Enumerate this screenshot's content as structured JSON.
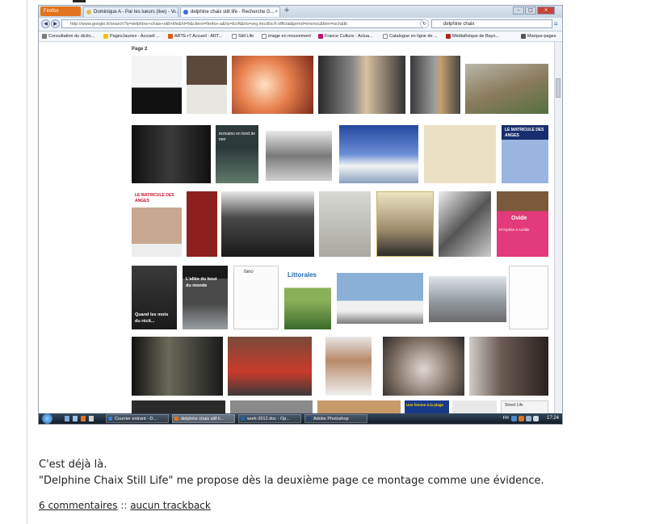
{
  "browser": {
    "app_button": "Firefox",
    "tabs": [
      {
        "label": "Dominique A - Par les lueurs (live) - V...",
        "active": false,
        "icon_color": "#d9c25a"
      },
      {
        "label": "delphine chaix still life - Recherche G...",
        "active": true,
        "icon_color": "#3b6fd6"
      }
    ],
    "new_tab": "+",
    "url": "http://www.google.fr/search?q=delphine+chaix+still+life&hl=fr&client=firefox-a&hs=EoN&rls=org.mozilla:fr:official&prmd=imvnsc&tbm=isch&tb",
    "search_text": "delphine chaix",
    "bookmarks": [
      {
        "label": "Consultation du dictio...",
        "icon_color": "#7a7a7a"
      },
      {
        "label": "PagesJaunes - Accueil ...",
        "icon_color": "#f1c400"
      },
      {
        "label": "ARTE+7 Accueil - ART...",
        "icon_color": "#e05a1a"
      },
      {
        "label": "Still Life",
        "icon_color": "#ffffff"
      },
      {
        "label": "image en mouvement",
        "icon_color": "#ffffff"
      },
      {
        "label": "France Culture - Actua...",
        "icon_color": "#c0136b"
      },
      {
        "label": "Catalogue en ligne de ...",
        "icon_color": "#ffffff"
      },
      {
        "label": "Médiathèque de Bayo...",
        "icon_color": "#b3261e"
      },
      {
        "label": "Marque-pages",
        "icon_color": "#555555"
      }
    ]
  },
  "results": {
    "page_label": "Page 2",
    "captions": {
      "r2_2": "écrivains en bord de mer",
      "r2_6": "LE MATRICULE DES ANGES",
      "r3_1": "LE MATRICULE DES ANGES",
      "r3_7a": "Ovide",
      "r3_7b": "D'Orphée à Achille",
      "r4_2a": "L'allée du bout",
      "r4_2b": "du monde",
      "r4_1a": "Quand les mots",
      "r4_1b": "du récit...",
      "r4_3": "fano",
      "r4_4": "Littorales",
      "r6_5": "Une femme à la plage",
      "r6_7": "Street Life"
    }
  },
  "taskbar": {
    "items": [
      {
        "label": "Courrier entrant - D...",
        "icon_color": "#3a7bd5"
      },
      {
        "label": "delphine chaix still li...",
        "icon_color": "#e1731f"
      },
      {
        "label": "work-2012.doc - Op...",
        "icon_color": "#1e62b0"
      },
      {
        "label": "Adobe Photoshop",
        "icon_color": "#27427a"
      }
    ],
    "lang": "FR",
    "clock": "17:24"
  },
  "post": {
    "line1": "C'est déjà là.",
    "line2": "\"Delphine Chaix Still Life\" me propose dès la deuxième page ce montage comme une évidence.",
    "comments_link": "6 commentaires",
    "separator": "::",
    "trackback_link": "aucun trackback"
  }
}
